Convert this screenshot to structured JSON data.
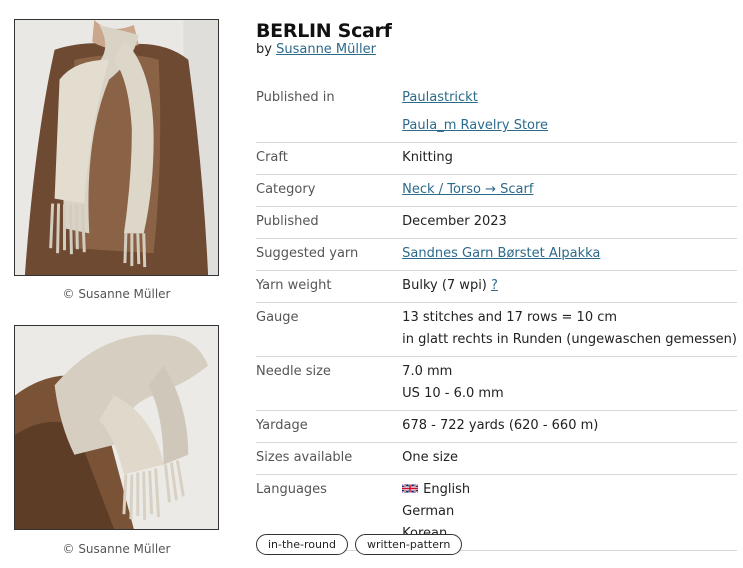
{
  "pattern": {
    "title": "BERLIN Scarf",
    "by_prefix": "by",
    "designer": "Susanne Müller"
  },
  "photos": [
    {
      "credit": "© Susanne Müller"
    },
    {
      "credit": "© Susanne Müller"
    }
  ],
  "details": {
    "published_in": {
      "label": "Published in",
      "values": [
        "Paulastrickt",
        "Paula_m Ravelry Store"
      ]
    },
    "craft": {
      "label": "Craft",
      "value": "Knitting"
    },
    "category": {
      "label": "Category",
      "value": "Neck / Torso → Scarf"
    },
    "published": {
      "label": "Published",
      "value": "December 2023"
    },
    "suggested_yarn": {
      "label": "Suggested yarn",
      "value": "Sandnes Garn Børstet Alpakka"
    },
    "yarn_weight": {
      "label": "Yarn weight",
      "value": "Bulky (7 wpi)",
      "help": "?"
    },
    "gauge": {
      "label": "Gauge",
      "values": [
        "13 stitches and 17 rows = 10 cm",
        "in glatt rechts in Runden (ungewaschen gemessen)"
      ]
    },
    "needle_size": {
      "label": "Needle size",
      "values": [
        "7.0 mm",
        "US 10 - 6.0 mm"
      ]
    },
    "yardage": {
      "label": "Yardage",
      "value": "678 - 722 yards (620 - 660 m)"
    },
    "sizes": {
      "label": "Sizes available",
      "value": "One size"
    },
    "languages": {
      "label": "Languages",
      "values": [
        "English",
        "German",
        "Korean"
      ],
      "flag_icon": "uk-flag-icon"
    }
  },
  "tags": [
    "in-the-round",
    "written-pattern"
  ],
  "colors": {
    "link": "#2c6a8a",
    "border": "#d8d8d8"
  }
}
